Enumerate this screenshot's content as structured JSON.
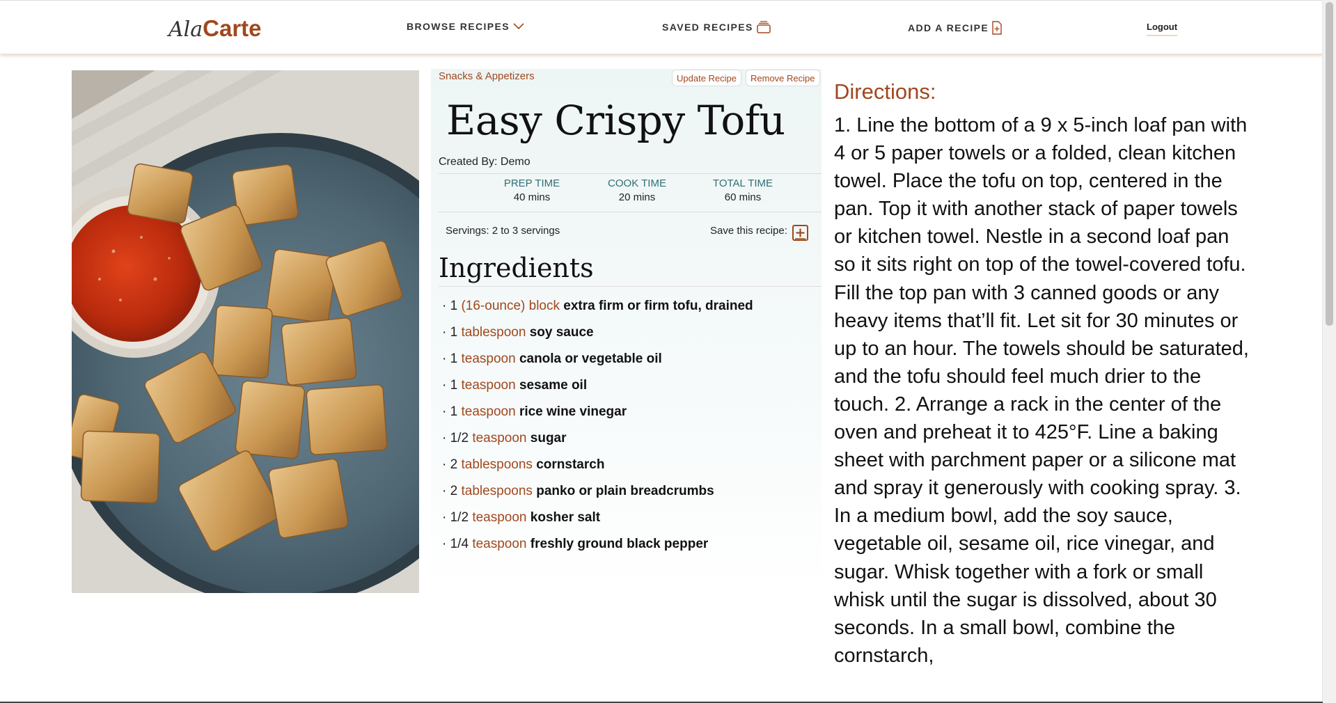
{
  "nav": {
    "logo_script": "Ala",
    "logo_bold": "Carte",
    "browse": "BROWSE RECIPES",
    "saved": "SAVED RECIPES",
    "add": "ADD A RECIPE",
    "logout": "Logout"
  },
  "recipe": {
    "category": "Snacks & Appetizers",
    "update_label": "Update Recipe",
    "remove_label": "Remove Recipe",
    "title": "Easy Crispy Tofu",
    "created_by": "Created By: Demo",
    "prep_label": "PREP TIME",
    "prep_value": "40 mins",
    "cook_label": "COOK TIME",
    "cook_value": "20 mins",
    "total_label": "TOTAL TIME",
    "total_value": "60 mins",
    "servings": "Servings: 2 to 3 servings",
    "save_label": "Save this recipe:",
    "ingredients_heading": "Ingredients",
    "ingredients": [
      {
        "qty": "1",
        "unit": "(16-ounce) block",
        "name": "extra firm or firm tofu, drained"
      },
      {
        "qty": "1",
        "unit": "tablespoon",
        "name": "soy sauce"
      },
      {
        "qty": "1",
        "unit": "teaspoon",
        "name": "canola or vegetable oil"
      },
      {
        "qty": "1",
        "unit": "teaspoon",
        "name": "sesame oil"
      },
      {
        "qty": "1",
        "unit": "teaspoon",
        "name": "rice wine vinegar"
      },
      {
        "qty": "1/2",
        "unit": "teaspoon",
        "name": "sugar"
      },
      {
        "qty": "2",
        "unit": "tablespoons",
        "name": "cornstarch"
      },
      {
        "qty": "2",
        "unit": "tablespoons",
        "name": "panko or plain breadcrumbs"
      },
      {
        "qty": "1/2",
        "unit": "teaspoon",
        "name": "kosher salt"
      },
      {
        "qty": "1/4",
        "unit": "teaspoon",
        "name": "freshly ground black pepper"
      }
    ],
    "directions_heading": "Directions:",
    "directions": "1. Line the bottom of a 9 x 5-inch loaf pan with 4 or 5 paper towels or a folded, clean kitchen towel. Place the tofu on top, centered in the pan. Top it with another stack of paper towels or kitchen towel. Nestle in a second loaf pan so it sits right on top of the towel-covered tofu. Fill the top pan with 3 canned goods or any heavy items that’ll fit. Let sit for 30 minutes or up to an hour. The towels should be saturated, and the tofu should feel much drier to the touch. 2. Arrange a rack in the center of the oven and preheat it to 425°F. Line a baking sheet with parchment paper or a silicone mat and spray it generously with cooking spray. 3. In a medium bowl, add the soy sauce, vegetable oil, sesame oil, rice vinegar, and sugar. Whisk together with a fork or small whisk until the sugar is dissolved, about 30 seconds. In a small bowl, combine the cornstarch,"
  },
  "colors": {
    "accent": "#a0481e",
    "teal": "#2f6f75",
    "card_bg": "#eef5f5"
  }
}
